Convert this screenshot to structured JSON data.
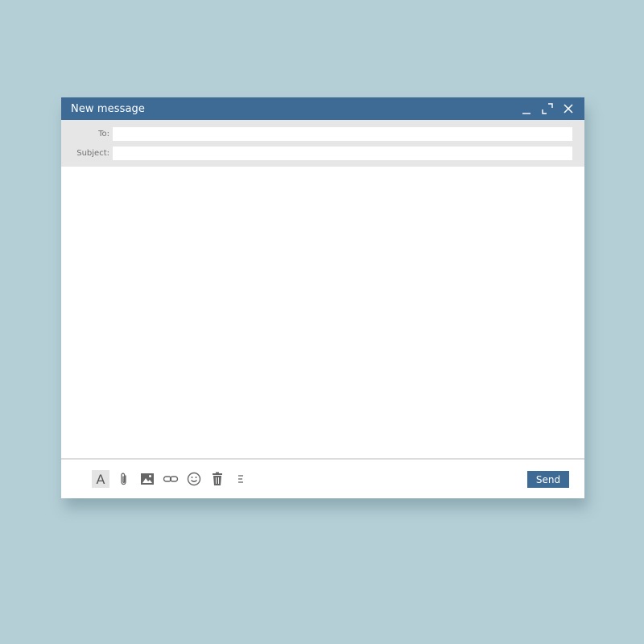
{
  "window": {
    "title": "New message"
  },
  "fields": {
    "to_label": "To:",
    "to_value": "",
    "subject_label": "Subject:",
    "subject_value": ""
  },
  "body": {
    "value": ""
  },
  "toolbar": {
    "format_label": "A",
    "send_label": "Send",
    "icons": [
      "format-text-icon",
      "paperclip-icon",
      "image-icon",
      "link-icon",
      "emoji-icon",
      "trash-icon",
      "more-icon"
    ]
  },
  "colors": {
    "background": "#b5cfd7",
    "accent": "#3e6b96",
    "header_fields_bg": "#e6e6e6",
    "icon": "#666666"
  }
}
